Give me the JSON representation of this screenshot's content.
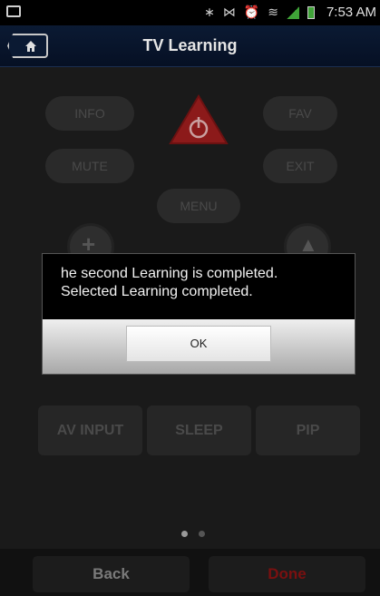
{
  "status_bar": {
    "time": "7:53 AM"
  },
  "title_bar": {
    "title": "TV Learning"
  },
  "remote": {
    "info": "INFO",
    "fav": "FAV",
    "mute": "MUTE",
    "exit": "EXIT",
    "menu": "MENU",
    "av_input": "AV INPUT",
    "sleep": "SLEEP",
    "pip": "PIP",
    "page_indicator": {
      "pages": 2,
      "current": 1
    }
  },
  "dialog": {
    "message": "he second Learning is completed.\nSelected Learning completed.",
    "ok_label": "OK"
  },
  "bottom_bar": {
    "back_label": "Back",
    "done_label": "Done"
  },
  "colors": {
    "power_red": "#8c1a1a",
    "done_red": "#7a1010",
    "title_bg": "#0b1a33"
  }
}
